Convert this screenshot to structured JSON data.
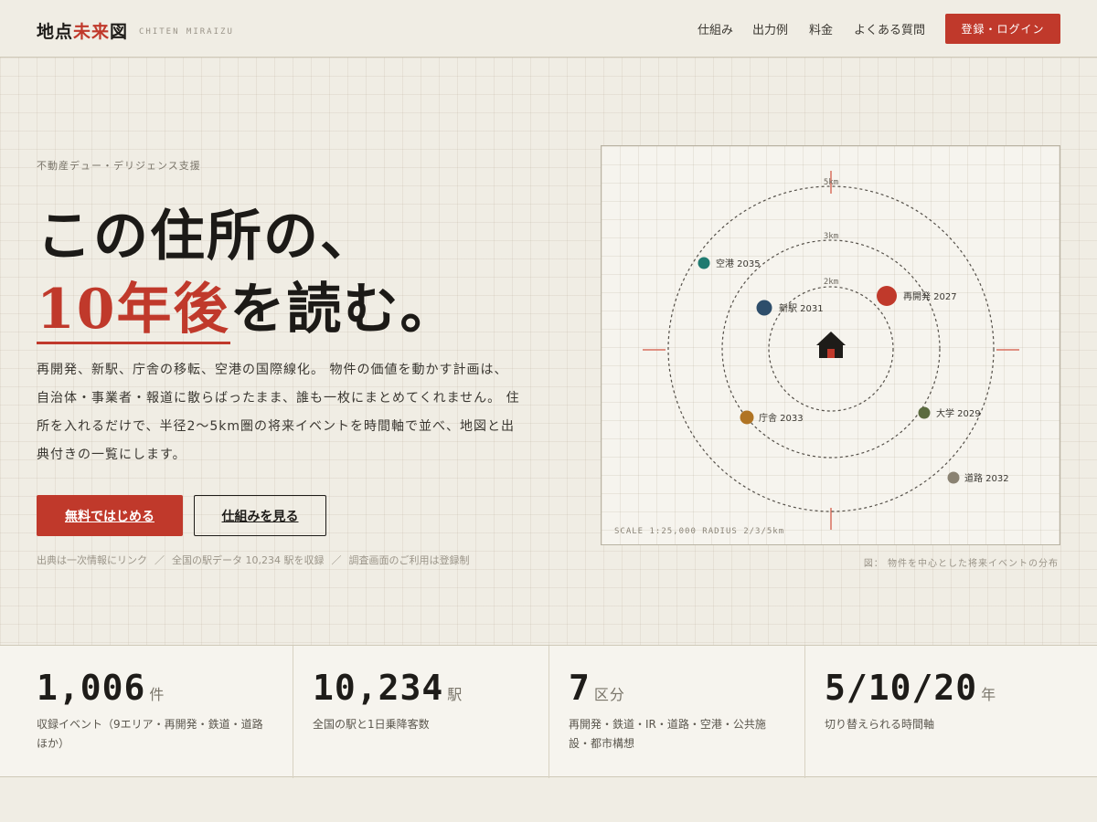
{
  "header": {
    "logo_part1": "地点",
    "logo_accent": "未来",
    "logo_part2": "図",
    "logo_sub": "CHITEN MIRAIZU",
    "nav": [
      "仕組み",
      "出力例",
      "料金",
      "よくある質問"
    ],
    "login_label": "登録・ログイン"
  },
  "hero": {
    "eyebrow": "不動産デュー・デリジェンス支援",
    "headline_line1": "この住所の、",
    "headline_accent": "10年後",
    "headline_rest": "を読む。",
    "lead": "再開発、新駅、庁舎の移転、空港の国際線化。 物件の価値を動かす計画は、自治体・事業者・報道に散らばったまま、誰も一枚にまとめてくれません。 住所を入れるだけで、半径2〜5km圏の将来イベントを時間軸で並べ、地図と出典付きの一覧にします。",
    "cta_primary": "無料ではじめる",
    "cta_secondary": "仕組みを見る",
    "footnotes": [
      "出典は一次情報にリンク",
      "全国の駅データ 10,234 駅を収録",
      "調査画面のご利用は登録制"
    ],
    "footnote_sep": "／"
  },
  "map": {
    "rings": [
      {
        "label": "2km",
        "radius_km": 2
      },
      {
        "label": "3km",
        "radius_km": 3
      },
      {
        "label": "5km",
        "radius_km": 5
      }
    ],
    "events": [
      {
        "label": "空港 2035",
        "color": "#1f7a70"
      },
      {
        "label": "再開発 2027",
        "color": "#c0392b"
      },
      {
        "label": "新駅 2031",
        "color": "#2e4e6b"
      },
      {
        "label": "庁舎 2033",
        "color": "#b07424"
      },
      {
        "label": "大学 2029",
        "color": "#5b6b3f"
      },
      {
        "label": "道路 2032",
        "color": "#8a8272"
      }
    ],
    "center_icon": "house-icon",
    "scale_text": "SCALE 1:25,000  RADIUS 2/3/5km",
    "caption": "図： 物件を中心とした将来イベントの分布"
  },
  "stats": [
    {
      "num": "1,006",
      "unit": "件",
      "desc": "収録イベント（9エリア・再開発・鉄道・道路ほか）"
    },
    {
      "num": "10,234",
      "unit": "駅",
      "desc": "全国の駅と1日乗降客数"
    },
    {
      "num": "7",
      "unit": "区分",
      "desc": "再開発・鉄道・IR・道路・空港・公共施設・都市構想"
    },
    {
      "num": "5/10/20",
      "unit": "年",
      "desc": "切り替えられる時間軸"
    }
  ],
  "colors": {
    "accent": "#c0392b",
    "background": "#f0ede4",
    "ink": "#1e1c19"
  }
}
